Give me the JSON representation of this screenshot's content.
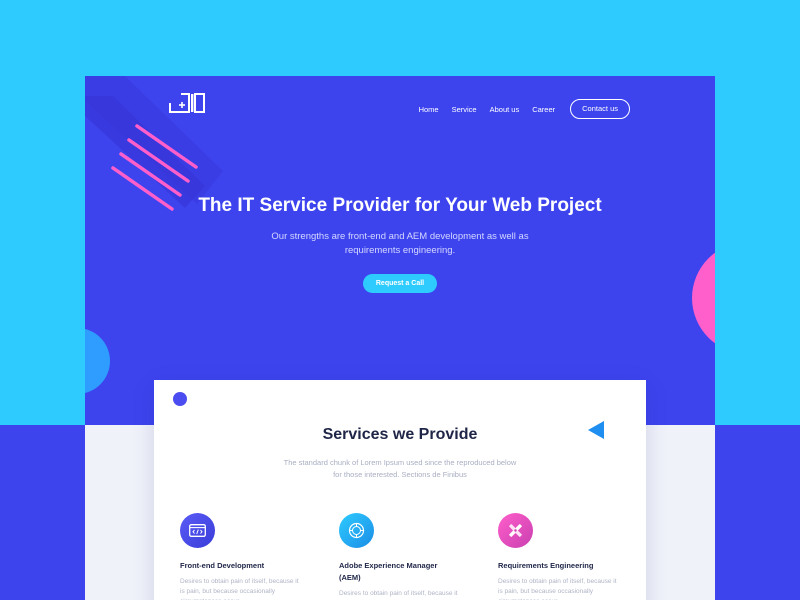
{
  "brand": {
    "logo_icon": "io-logo-mark"
  },
  "nav": {
    "items": [
      {
        "label": "Home"
      },
      {
        "label": "Service"
      },
      {
        "label": "About us"
      },
      {
        "label": "Career"
      }
    ],
    "contact_label": "Contact us"
  },
  "hero": {
    "title": "The IT Service Provider for Your Web Project",
    "subtitle": "Our strengths are front-end and AEM development as well as requirements engineering.",
    "cta_label": "Request a Call"
  },
  "services": {
    "title": "Services we Provide",
    "subtitle": "The standard chunk of Lorem Ipsum used since the reproduced below for those interested. Sections de Finibus",
    "items": [
      {
        "icon": "code-window-icon",
        "title": "Front-end Development",
        "description": "Desires to obtain pain of itself, because it is pain, but because occasionally circumstances occur"
      },
      {
        "icon": "aem-badge-icon",
        "title": "Adobe Experience Manager (AEM)",
        "description": "Desires to obtain pain of itself, because it is pain, but because occasionally circumstances occur"
      },
      {
        "icon": "pencil-ruler-icon",
        "title": "Requirements Engineering",
        "description": "Desires to obtain pain of itself, because it is pain, but because occasionally circumstances occur"
      }
    ]
  },
  "colors": {
    "background_cyan": "#2ecbff",
    "hero_blue": "#3d44ee",
    "accent_pink": "#ff5fcb",
    "heading_dark": "#1f2547",
    "muted_text": "#a9aec2"
  }
}
